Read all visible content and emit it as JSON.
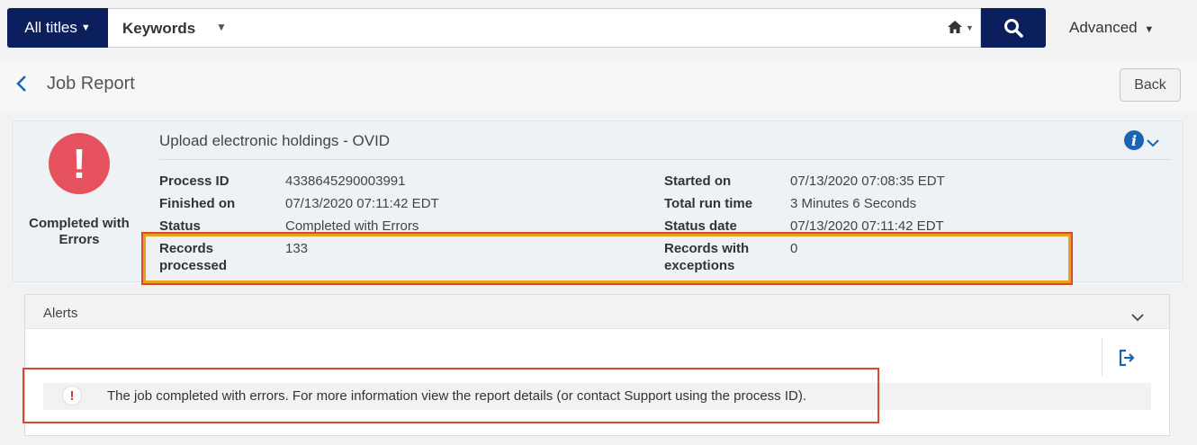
{
  "search": {
    "scope_label": "All titles",
    "field_label": "Keywords",
    "advanced_label": "Advanced"
  },
  "page": {
    "title": "Job Report",
    "back_button": "Back"
  },
  "job": {
    "status_summary_line1": "Completed with",
    "status_summary_line2": "Errors",
    "title": "Upload electronic holdings - OVID",
    "fields_left": [
      {
        "label": "Process ID",
        "value": "4338645290003991"
      },
      {
        "label": "Finished on",
        "value": "07/13/2020 07:11:42 EDT"
      },
      {
        "label": "Status",
        "value": "Completed with Errors"
      },
      {
        "label_line1": "Records",
        "label_line2": "processed",
        "value": "133"
      }
    ],
    "fields_right": [
      {
        "label": "Started on",
        "value": "07/13/2020 07:08:35 EDT"
      },
      {
        "label": "Total run time",
        "value": "3 Minutes 6 Seconds"
      },
      {
        "label": "Status date",
        "value": "07/13/2020 07:11:42 EDT"
      },
      {
        "label_line1": "Records with",
        "label_line2": "exceptions",
        "value": "0"
      }
    ]
  },
  "alerts": {
    "title": "Alerts",
    "message": "The job completed with errors. For more information view the report details (or contact Support using the process ID)."
  },
  "colors": {
    "nav_dark": "#0a1f5c",
    "error_red": "#e5515d",
    "info_blue": "#1b64b4",
    "highlight_orange": "#e6a21a",
    "highlight_red": "#d8492e"
  }
}
